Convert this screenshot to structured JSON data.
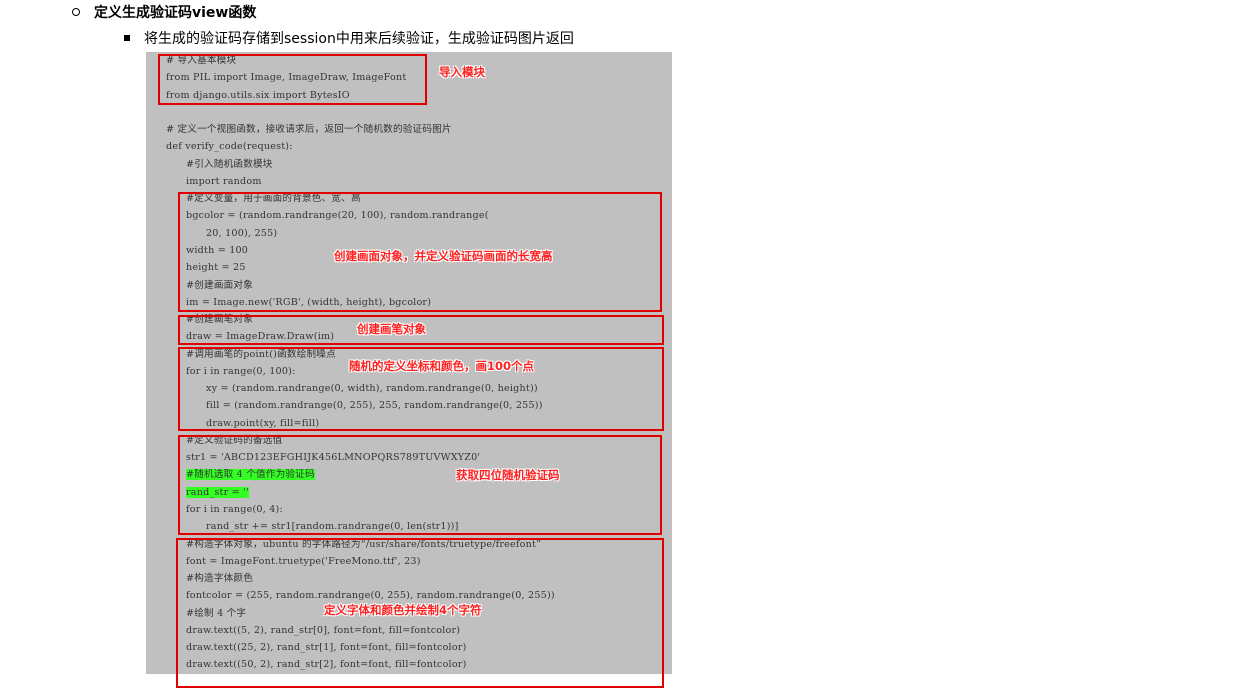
{
  "heading": {
    "label": "定义生成验证码view函数"
  },
  "subitem": {
    "label": "将生成的验证码存储到session中用来后续验证，生成验证码图片返回"
  },
  "code": {
    "lines": [
      "# 导入基本模块",
      "from PIL import Image, ImageDraw, ImageFont",
      "from django.utils.six import BytesIO",
      "",
      "# 定义一个视图函数，接收请求后，返回一个随机数的验证码图片",
      "def verify_code(request):",
      "    #引入随机函数模块",
      "    import random",
      "    #定义变量，用于画面的背景色、宽、高",
      "    bgcolor = (random.randrange(20, 100), random.randrange(",
      "        20, 100), 255)",
      "    width = 100",
      "    height = 25",
      "    #创建画面对象",
      "    im = Image.new('RGB', (width, height), bgcolor)",
      "    #创建画笔对象",
      "    draw = ImageDraw.Draw(im)",
      "    #调用画笔的point()函数绘制噪点",
      "    for i in range(0, 100):",
      "        xy = (random.randrange(0, width), random.randrange(0, height))",
      "        fill = (random.randrange(0, 255), 255, random.randrange(0, 255))",
      "        draw.point(xy, fill=fill)",
      "    #定义验证码的备选值",
      "    str1 = 'ABCD123EFGHIJK456LMNOPQRS789TUVWXYZ0'",
      "    #随机选取 4 个值作为验证码",
      "    rand_str = ''",
      "    for i in range(0, 4):",
      "        rand_str += str1[random.randrange(0, len(str1))]",
      "    #构造字体对象，ubuntu 的字体路径为“/usr/share/fonts/truetype/freefont”",
      "    font = ImageFont.truetype('FreeMono.ttf', 23)",
      "    #构造字体颜色",
      "    fontcolor = (255, random.randrange(0, 255), random.randrange(0, 255))",
      "    #绘制 4 个字",
      "    draw.text((5, 2), rand_str[0], font=font, fill=fontcolor)",
      "    draw.text((25, 2), rand_str[1], font=font, fill=fontcolor)",
      "    draw.text((50, 2), rand_str[2], font=font, fill=fontcolor)"
    ],
    "highlighted": [
      "    #随机选取 4 个值作为验证码",
      "    rand_str = ''"
    ]
  },
  "annotations": {
    "import": "导入模块",
    "canvas": "创建画面对象，并定义验证码画面的长宽高",
    "brush": "创建画笔对象",
    "points": "随机的定义坐标和颜色，画100个点",
    "random": "获取四位随机验证码",
    "font": "定义字体和颜色并绘制4个字符"
  },
  "colors": {
    "annotation": "#ff2020",
    "box": "#e00000",
    "code_bg": "#c0c0c0",
    "highlight": "#33ff22"
  }
}
